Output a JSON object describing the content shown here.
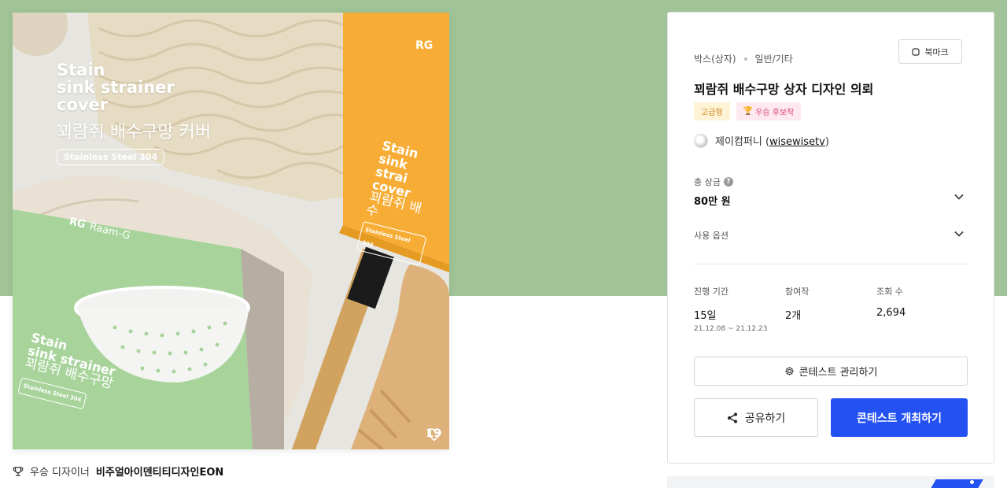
{
  "image": {
    "title_lines": [
      "Stain",
      "sink strainer",
      "cover"
    ],
    "subtitle": "꾀람쥐 배수구망 커버",
    "pill": "Stainless Steel 304",
    "brand": "Raam-G",
    "brand_mark": "RG",
    "orange_box_text": [
      "Stain",
      "sink strai",
      "cover",
      "꾀람쥐 배수",
      "Stainless Steel 304"
    ],
    "green_box_text": [
      "Stain",
      "sink strainer",
      "꾀람쥐 배수구망",
      "Stainless Steel 304"
    ],
    "likes": "19"
  },
  "designer": {
    "label": "우승 디자이너",
    "name": "비주얼아이덴티티디자인EON"
  },
  "card": {
    "category": "박스(상자)",
    "subcategory": "일반/기타",
    "bookmark_label": "북마크",
    "title": "꾀람쥐 배수구망 상자 디자인 의뢰",
    "badges": {
      "premium": "고급형",
      "candidate": "우승 후보작"
    },
    "host_name": "제이컴퍼니",
    "host_handle": "wisewisetv",
    "prize_label": "총 상금",
    "prize_value": "80만 원",
    "usage_label": "사용 옵션",
    "stats": {
      "period_label": "진행 기간",
      "period_value": "15일",
      "period_range": "21.12.08 ~ 21.12.23",
      "entries_label": "참여작",
      "entries_value": "2개",
      "views_label": "조회 수",
      "views_value": "2,694"
    },
    "manage_label": "콘테스트 관리하기",
    "share_label": "공유하기",
    "host_button_label": "콘테스트 개최하기"
  },
  "colors": {
    "hero": "#a0c497",
    "primary": "#2451f2",
    "orange_box": "#f7ad35",
    "green_box": "#a8d49c"
  }
}
